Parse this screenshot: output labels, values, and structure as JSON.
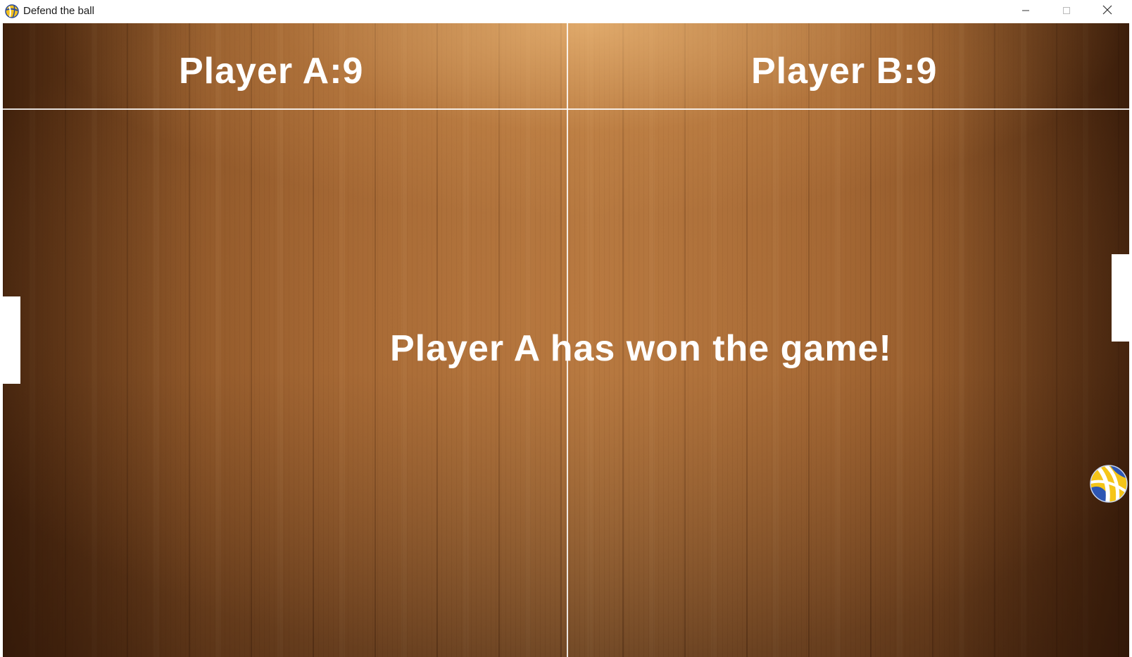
{
  "window": {
    "title": "Defend the ball",
    "app_icon": "volleyball-icon",
    "controls": {
      "minimize": "minimize-icon",
      "maximize": "maximize-icon",
      "close": "close-icon"
    }
  },
  "game": {
    "score_a": "Player A:9",
    "score_b": "Player B:9",
    "message": "Player A has won the game!",
    "ball_icon": "volleyball-icon",
    "colors": {
      "text": "#ffffff",
      "lines": "#ffffff",
      "paddles": "#ffffff",
      "court": "#9c6231"
    }
  }
}
